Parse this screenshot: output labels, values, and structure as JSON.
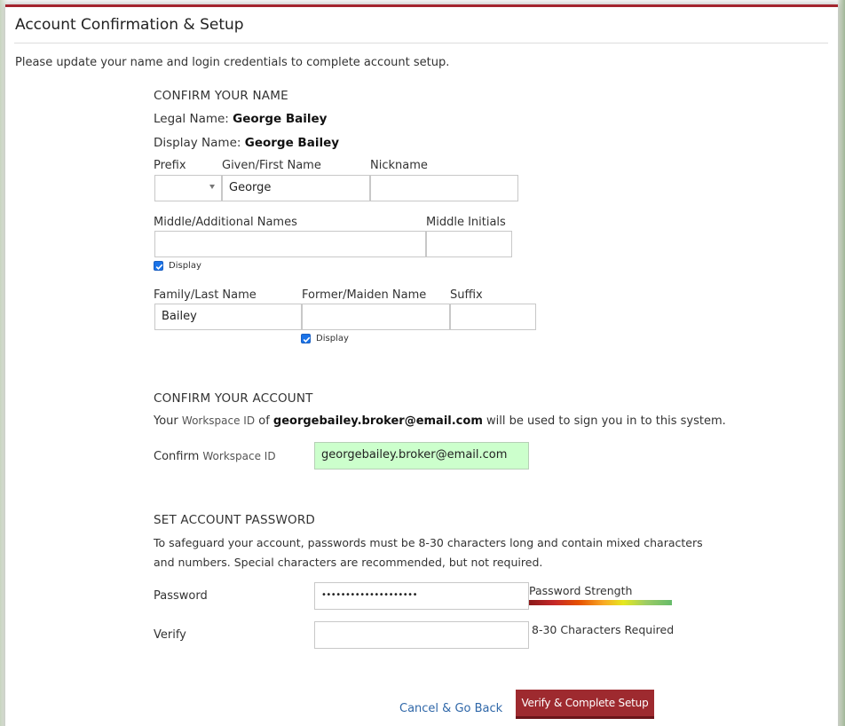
{
  "modal": {
    "title": "Account Confirmation & Setup",
    "intro": "Please update your name and login credentials to complete account setup."
  },
  "name_section": {
    "heading": "CONFIRM YOUR NAME",
    "legal_label": "Legal Name:",
    "legal_value": "George Bailey",
    "display_label": "Display Name:",
    "display_value": "George Bailey",
    "prefix_label": "Prefix",
    "prefix_value": "",
    "given_label": "Given/First Name",
    "given_value": "George",
    "nickname_label": "Nickname",
    "nickname_value": "",
    "middle_label": "Middle/Additional Names",
    "middle_value": "",
    "middle_initials_label": "Middle Initials",
    "middle_initials_value": "",
    "middle_display_label": "Display",
    "family_label": "Family/Last Name",
    "family_value": "Bailey",
    "former_label": "Former/Maiden Name",
    "former_value": "",
    "former_display_label": "Display",
    "suffix_label": "Suffix",
    "suffix_value": ""
  },
  "account_section": {
    "heading": "CONFIRM YOUR ACCOUNT",
    "your": "Your",
    "workspace_id": "Workspace ID",
    "of": "of",
    "email": "georgebailey.broker@email.com",
    "suffix_text": "will be used to sign you in to this system.",
    "confirm_label": "Confirm",
    "confirm_value": "georgebailey.broker@email.com"
  },
  "password_section": {
    "heading": "SET ACCOUNT PASSWORD",
    "desc_line1": "To safeguard your account, passwords must be 8-30 characters long and contain mixed characters",
    "desc_line2": "and numbers. Special characters are recommended, but not required.",
    "password_label": "Password",
    "password_value": "••••••••••••••••••••",
    "strength_label": "Password Strength",
    "verify_label": "Verify",
    "verify_value": "",
    "requirement": "8-30 Characters Required"
  },
  "actions": {
    "cancel_label": "Cancel & Go Back",
    "submit_label": "Verify & Complete Setup"
  },
  "colors": {
    "brand": "#9e2a2f",
    "link": "#2f67a8",
    "confirmed_field": "#ccffcc"
  }
}
